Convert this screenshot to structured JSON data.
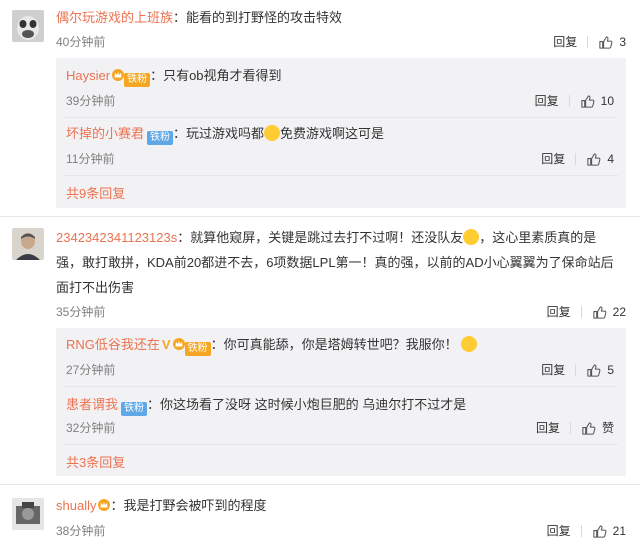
{
  "comments": [
    {
      "user": "偶尔玩游戏的上班族",
      "text": "：能看的到打野怪的攻击特效",
      "time": "40分钟前",
      "reply_label": "回复",
      "likes": "3",
      "replies": [
        {
          "user": "Haysier",
          "badge": "铁粉",
          "text": "：只有ob视角才看得到",
          "time": "39分钟前",
          "reply_label": "回复",
          "likes": "10"
        },
        {
          "user": "坏掉的小赛君",
          "badge": "铁粉",
          "text_before": "：玩过游戏吗都",
          "text_after": "免费游戏啊这可是",
          "time": "11分钟前",
          "reply_label": "回复",
          "likes": "4"
        }
      ],
      "more": "共9条回复"
    },
    {
      "user": "2342342341123123s",
      "line1_before": "：就算他窥屏，关键是跳过去打不过啊！还没队友",
      "line1_after": "，这心里素质真的是",
      "line2": "强，敢打敢拼，KDA前20都进不去，6项数据LPL第一！真的强，以前的AD小心翼翼为了保命站后",
      "line3": "面打不出伤害",
      "time": "35分钟前",
      "reply_label": "回复",
      "likes": "22",
      "replies": [
        {
          "user": "RNG低谷我还在",
          "badge": "铁粉",
          "text": "：你可真能舔，你是塔姆转世吧？我服你！",
          "time": "27分钟前",
          "reply_label": "回复",
          "likes": "5"
        },
        {
          "user": "患者谓我",
          "badge": "铁粉",
          "text": "：你这场看了没呀  这时候小炮巨肥的  乌迪尔打不过才是",
          "time": "32分钟前",
          "reply_label": "回复",
          "likes": "赞"
        }
      ],
      "more": "共3条回复"
    },
    {
      "user": "shually",
      "text": "：我是打野会被吓到的程度",
      "time": "38分钟前",
      "reply_label": "回复",
      "likes": "21"
    }
  ],
  "colors": {
    "username": "#eb7350",
    "reply_bg": "#f2f2f5",
    "time": "#808080",
    "badge_blue": "#5fa8e7",
    "badge_gold": "#f5a623"
  }
}
